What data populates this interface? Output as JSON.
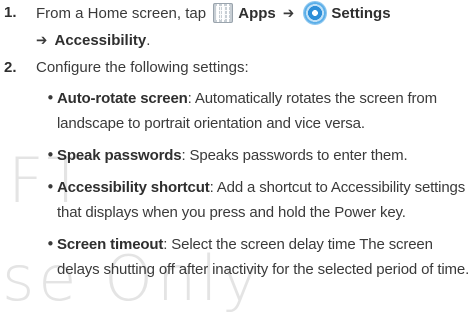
{
  "watermark": {
    "line1": "FT",
    "line2": "se Only"
  },
  "steps": [
    {
      "number": "1.",
      "text_before": "From a Home screen, tap",
      "apps_label": "Apps",
      "arrow1": "➔",
      "settings_label": "Settings",
      "arrow2": "➔",
      "accessibility_label": "Accessibility",
      "end": "."
    },
    {
      "number": "2.",
      "text": "Configure the following settings:"
    }
  ],
  "bullets": [
    {
      "term": "Auto-rotate screen",
      "desc": ": Automatically rotates the screen from landscape to portrait orientation and vice versa."
    },
    {
      "term": "Speak passwords",
      "desc": ": Speaks passwords to enter them."
    },
    {
      "term": "Accessibility shortcut",
      "desc": ": Add a shortcut to Accessibility settings that displays when you press and hold the Power key."
    },
    {
      "term": "Screen timeout",
      "desc": ": Select the screen delay time The screen delays shutting off after inactivity for the selected period of time."
    }
  ],
  "icons": {
    "apps": "apps-grid-icon",
    "settings": "settings-gear-icon"
  },
  "colors": {
    "text": "#3a3a3a",
    "gear_accent": "#2f8fd8"
  }
}
